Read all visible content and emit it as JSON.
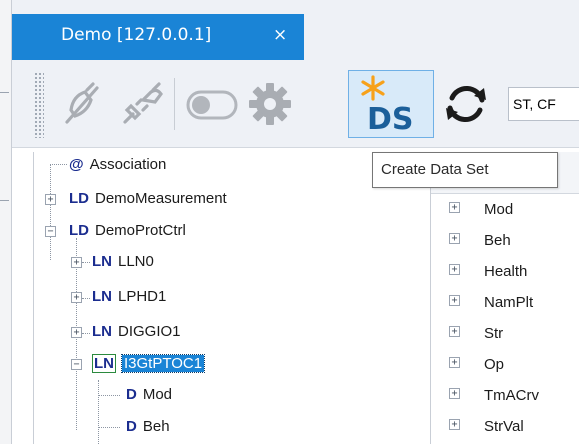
{
  "tab": {
    "title": "Demo [127.0.0.1]",
    "close_glyph": "×"
  },
  "toolbar": {
    "buttons": [
      {
        "icon": "disconnected-plug-icon",
        "enabled": false
      },
      {
        "icon": "connect-plug-icon",
        "enabled": false
      },
      {
        "icon": "toggle-switch-icon",
        "enabled": false
      },
      {
        "icon": "gear-icon",
        "enabled": false
      },
      {
        "icon": "create-data-set-icon",
        "text": "DS",
        "enabled": true,
        "active": true
      },
      {
        "icon": "refresh-icon",
        "enabled": true
      }
    ],
    "combo_value": "ST, CF",
    "tooltip": "Create Data Set"
  },
  "colors": {
    "accent": "#1a84d6",
    "node_kind": "#1b2d8f",
    "create_star": "#f7a11a"
  },
  "tree": {
    "nodes": [
      {
        "kind": "@",
        "label": "Association",
        "expander": ""
      },
      {
        "kind": "LD",
        "label": "DemoMeasurement",
        "expander": "+"
      },
      {
        "kind": "LD",
        "label": "DemoProtCtrl",
        "expander": "−"
      },
      {
        "kind": "LN",
        "label": "LLN0",
        "expander": "+"
      },
      {
        "kind": "LN",
        "label": "LPHD1",
        "expander": "+"
      },
      {
        "kind": "LN",
        "label": "DIGGIO1",
        "expander": "+"
      },
      {
        "kind": "LN",
        "label": "I3GtPTOC1",
        "expander": "−",
        "selected": true
      },
      {
        "kind": "D",
        "label": "Mod",
        "expander": ""
      },
      {
        "kind": "D",
        "label": "Beh",
        "expander": ""
      }
    ]
  },
  "right_list": {
    "items": [
      {
        "label": "Mod",
        "expander": "+"
      },
      {
        "label": "Beh",
        "expander": "+"
      },
      {
        "label": "Health",
        "expander": "+"
      },
      {
        "label": "NamPlt",
        "expander": "+"
      },
      {
        "label": "Str",
        "expander": "+"
      },
      {
        "label": "Op",
        "expander": "+"
      },
      {
        "label": "TmACrv",
        "expander": "+"
      },
      {
        "label": "StrVal",
        "expander": "+"
      }
    ]
  }
}
